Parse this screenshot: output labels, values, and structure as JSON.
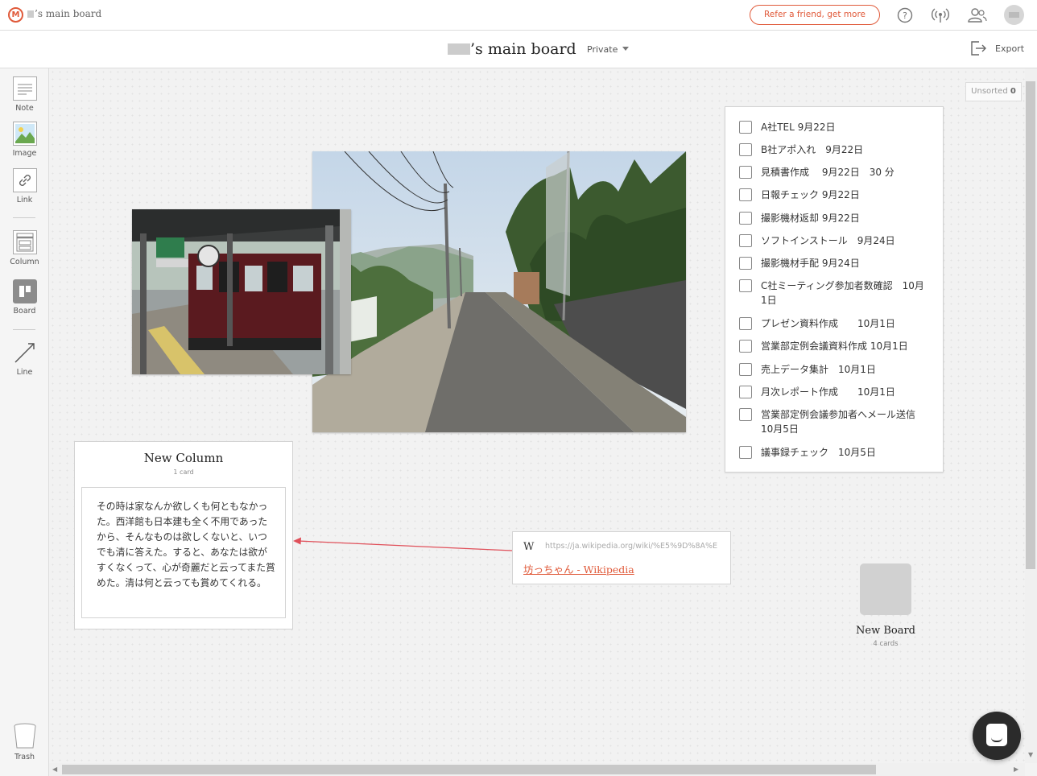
{
  "topbar": {
    "title": "’s main board",
    "refer_label": "Refer a friend, get more space",
    "icons": [
      "help-icon",
      "activity-icon",
      "share-users-icon",
      "avatar"
    ]
  },
  "board": {
    "title": "’s main board",
    "privacy": "Private",
    "export_label": "Export",
    "unsorted_label": "Unsorted",
    "unsorted_count": "0"
  },
  "toolbar": {
    "items": [
      {
        "label": "Note",
        "icon": "note-icon"
      },
      {
        "label": "Image",
        "icon": "image-icon"
      },
      {
        "label": "Link",
        "icon": "link-icon"
      },
      {
        "label": "Column",
        "icon": "column-icon"
      },
      {
        "label": "Board",
        "icon": "board-icon"
      },
      {
        "label": "Line",
        "icon": "line-icon"
      }
    ],
    "trash_label": "Trash"
  },
  "todo": {
    "items": [
      {
        "text": "A社TEL 9月22日",
        "checked": false
      },
      {
        "text": "B社アポ入れ　9月22日",
        "checked": false
      },
      {
        "text": "見積書作成　 9月22日　30 分",
        "checked": false
      },
      {
        "text": "日報チェック  9月22日",
        "checked": false
      },
      {
        "text": "撮影機材返却  9月22日",
        "checked": false
      },
      {
        "text": "ソフトインストール　9月24日",
        "checked": false
      },
      {
        "text": "撮影機材手配  9月24日",
        "checked": false
      },
      {
        "text": "C社ミーティング参加者数確認　10月1日",
        "checked": false
      },
      {
        "text": "プレゼン資料作成　　10月1日",
        "checked": false
      },
      {
        "text": "営業部定例会議資料作成 10月1日",
        "checked": false
      },
      {
        "text": "売上データ集計　10月1日",
        "checked": false
      },
      {
        "text": "月次レポート作成　　10月1日",
        "checked": false
      },
      {
        "text": "営業部定例会議参加者へメール送信 10月5日",
        "checked": false
      },
      {
        "text": "議事録チェック　10月5日",
        "checked": false
      }
    ]
  },
  "column": {
    "title": "New Column",
    "count": "1 card",
    "card_text": "その時は家なんか欲しくも何ともなかった。西洋館も日本建も全く不用であったから、そんなものは欲しくないと、いつでも清に答えた。すると、あなたは欲がすくなくって、心が奇麗だと云ってまた賞めた。清は何と云っても賞めてくれる。"
  },
  "link": {
    "url": "https://ja.wikipedia.org/wiki/%E5%9D%8A%E",
    "title": "坊っちゃん - Wikipedia",
    "icon": "wikipedia-w-icon"
  },
  "new_board": {
    "title": "New Board",
    "count": "4 cards"
  },
  "colors": {
    "accent": "#e05a3a",
    "arrow": "#e0505a"
  }
}
